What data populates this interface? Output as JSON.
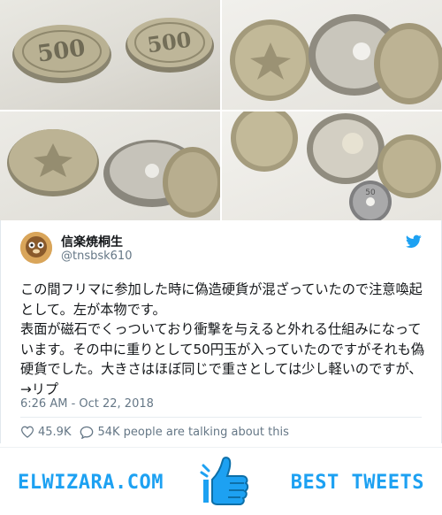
{
  "photos": [
    {
      "alt": "coin-photo-1"
    },
    {
      "alt": "coin-photo-2"
    },
    {
      "alt": "coin-photo-3"
    },
    {
      "alt": "coin-photo-4"
    }
  ],
  "tweet": {
    "display_name": "信楽焼桐生",
    "handle": "@tnsbsk610",
    "text": "この間フリマに参加した時に偽造硬貨が混ざっていたので注意喚起として。左が本物です。\n表面が磁石でくっついており衝撃を与えると外れる仕組みになっています。その中に重りとして50円玉が入っていたのですがそれも偽硬貨でした。大きさはほぼ同じで重さとしては少し軽いのですが、→リプ",
    "timestamp": "6:26 AM - Oct 22, 2018",
    "likes": "45.9K",
    "talking": "54K people are talking about this",
    "coin_labels": {
      "c500": "500",
      "c50": "50"
    }
  },
  "footer": {
    "brand": "ELWIZARA.COM",
    "tagline": "BEST TWEETS"
  },
  "colors": {
    "accent": "#1da1f2",
    "text": "#14171a",
    "muted": "#657786"
  },
  "icons": [
    "twitter-bird-icon",
    "heart-icon",
    "comment-icon",
    "thumbs-up-icon"
  ]
}
